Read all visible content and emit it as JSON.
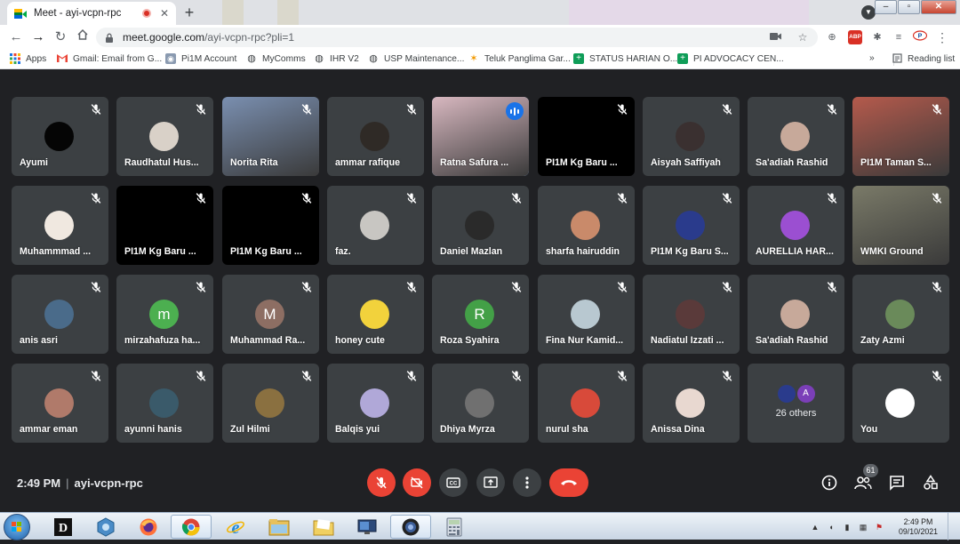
{
  "browser": {
    "tab_title": "Meet - ayi-vcpn-rpc",
    "url_host": "meet.google.com",
    "url_path": "/ayi-vcpn-rpc?pli=1",
    "new_tab_symbol": "+",
    "close_symbol": "✕"
  },
  "bookmarks": [
    {
      "label": "Apps",
      "icon": "apps-grid-icon"
    },
    {
      "label": "Gmail: Email from G...",
      "icon": "gmail-icon"
    },
    {
      "label": "Pi1M Account",
      "icon": "pi1m-icon"
    },
    {
      "label": "MyComms",
      "icon": "globe-icon"
    },
    {
      "label": "IHR V2",
      "icon": "globe-icon"
    },
    {
      "label": "USP Maintenance...",
      "icon": "globe-icon"
    },
    {
      "label": "Teluk Panglima Gar...",
      "icon": "star-icon"
    },
    {
      "label": "STATUS HARIAN O...",
      "icon": "sheets-icon"
    },
    {
      "label": "PI ADVOCACY CEN...",
      "icon": "sheets-icon"
    }
  ],
  "reading_list": "Reading list",
  "tiles": [
    {
      "name": "Ayumi",
      "style": "photo",
      "color": "#050505"
    },
    {
      "name": "Raudhatul Hus...",
      "style": "photo",
      "color": "#d9d1c8"
    },
    {
      "name": "Norita Rita",
      "style": "video",
      "color": "#7a8fb0"
    },
    {
      "name": "ammar rafique",
      "style": "photo",
      "color": "#2f2a26"
    },
    {
      "name": "Ratna Safura ...",
      "style": "video",
      "color": "#d8b8c0"
    },
    {
      "name": "PI1M Kg Baru ...",
      "style": "black",
      "color": "#000000"
    },
    {
      "name": "Aisyah Saffiyah",
      "style": "photo",
      "color": "#3a3030"
    },
    {
      "name": "Sa'adiah Rashid",
      "style": "photo",
      "color": "#c7a99a"
    },
    {
      "name": "PI1M Taman S...",
      "style": "video",
      "color": "#b55a4c"
    },
    {
      "name": "Muhammmad ...",
      "style": "photo",
      "color": "#f0e8e0"
    },
    {
      "name": "PI1M Kg Baru ...",
      "style": "black",
      "color": "#000000"
    },
    {
      "name": "PI1M Kg Baru ...",
      "style": "black",
      "color": "#000000"
    },
    {
      "name": "faz.",
      "style": "photo",
      "color": "#c8c6c2"
    },
    {
      "name": "Daniel Mazlan",
      "style": "photo",
      "color": "#2a2a2a"
    },
    {
      "name": "sharfa hairuddin",
      "style": "photo",
      "color": "#c98a6a"
    },
    {
      "name": "PI1M Kg Baru S...",
      "style": "photo",
      "color": "#2a3b8c"
    },
    {
      "name": "AURELLIA HAR...",
      "style": "photo",
      "color": "#9b4fd1"
    },
    {
      "name": "WMKI Ground",
      "style": "video",
      "color": "#7a7a68"
    },
    {
      "name": "anis asri",
      "style": "photo",
      "color": "#4a6b8a"
    },
    {
      "name": "mirzahafuza ha...",
      "style": "letter",
      "letter": "m",
      "color": "#4caf50"
    },
    {
      "name": "Muhammad Ra...",
      "style": "letter",
      "letter": "M",
      "color": "#8d6e63"
    },
    {
      "name": "honey cute",
      "style": "photo",
      "color": "#f2d23c"
    },
    {
      "name": "Roza Syahira",
      "style": "letter",
      "letter": "R",
      "color": "#43a047"
    },
    {
      "name": "Fina Nur Kamid...",
      "style": "photo",
      "color": "#b8c8d0"
    },
    {
      "name": "Nadiatul Izzati ...",
      "style": "photo",
      "color": "#5a3a3a"
    },
    {
      "name": "Sa'adiah Rashid",
      "style": "photo",
      "color": "#c7a99a"
    },
    {
      "name": "Zaty Azmi",
      "style": "photo",
      "color": "#6a8a5a"
    },
    {
      "name": "ammar eman",
      "style": "photo",
      "color": "#b07a6a"
    },
    {
      "name": "ayunni hanis",
      "style": "photo",
      "color": "#3a5a6a"
    },
    {
      "name": "Zul Hilmi",
      "style": "photo",
      "color": "#8a7040"
    },
    {
      "name": "Balqis yui",
      "style": "photo",
      "color": "#b0a8d8"
    },
    {
      "name": "Dhiya Myrza",
      "style": "photo",
      "color": "#707070"
    },
    {
      "name": "nurul sha",
      "style": "photo",
      "color": "#d84a3a"
    },
    {
      "name": "Anissa Dina",
      "style": "photo",
      "color": "#e8d8d0"
    },
    {
      "name": "",
      "style": "others",
      "color": "#3c4043"
    },
    {
      "name": "You",
      "style": "photo",
      "color": "#ffffff"
    }
  ],
  "others": {
    "label": "26 others",
    "letter": "A",
    "letter_color": "#7b3fb8",
    "logo_color": "#2a3b8c"
  },
  "meeting": {
    "time": "2:49 PM",
    "separator": "|",
    "code": "ayi-vcpn-rpc",
    "participant_count": "61"
  },
  "controls": {
    "mic_muted_color": "#ea4335",
    "end_call_color": "#ea4335"
  },
  "taskbar": {
    "time": "2:49 PM",
    "date": "09/10/2021",
    "apps": [
      "windows-start-icon",
      "dict-app-icon",
      "pc-app-icon",
      "firefox-icon",
      "chrome-icon",
      "ie-icon",
      "explorer-icon",
      "folder-icon",
      "monitor-app-icon",
      "camera-app-icon",
      "calculator-icon"
    ]
  }
}
